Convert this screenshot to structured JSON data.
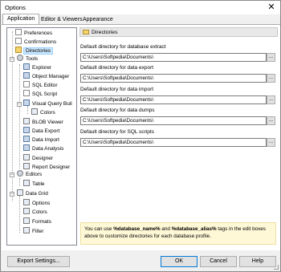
{
  "window": {
    "title": "Options",
    "close_glyph": "✕"
  },
  "tabs": [
    {
      "label": "Application",
      "active": true
    },
    {
      "label": "Editor & Viewers"
    },
    {
      "label": "Appearance"
    }
  ],
  "tree": {
    "items": [
      {
        "label": "Preferences",
        "icon": "preferences-icon"
      },
      {
        "label": "Confirmations",
        "icon": "confirmations-icon"
      },
      {
        "label": "Directories",
        "icon": "folder-icon",
        "selected": true
      },
      {
        "label": "Tools",
        "icon": "tools-icon"
      },
      {
        "label": "Explorer",
        "icon": "explorer-icon"
      },
      {
        "label": "Object Manager",
        "icon": "object-manager-icon"
      },
      {
        "label": "SQL Editor",
        "icon": "sql-editor-icon"
      },
      {
        "label": "SQL Script",
        "icon": "sql-script-icon"
      },
      {
        "label": "Visual Query Buil",
        "icon": "visual-query-icon"
      },
      {
        "label": "Colors",
        "icon": "colors-icon"
      },
      {
        "label": "BLOB Viewer",
        "icon": "blob-viewer-icon"
      },
      {
        "label": "Data Export",
        "icon": "data-export-icon"
      },
      {
        "label": "Data Import",
        "icon": "data-import-icon"
      },
      {
        "label": "Data Analysis",
        "icon": "data-analysis-icon"
      },
      {
        "label": "Designer",
        "icon": "designer-icon"
      },
      {
        "label": "Report Designer",
        "icon": "report-designer-icon"
      },
      {
        "label": "Editors",
        "icon": "editors-icon"
      },
      {
        "label": "Table",
        "icon": "table-icon"
      },
      {
        "label": "Data Grid",
        "icon": "data-grid-icon"
      },
      {
        "label": "Options",
        "icon": "options-icon"
      },
      {
        "label": "Colors",
        "icon": "colors-icon"
      },
      {
        "label": "Formats",
        "icon": "formats-icon"
      },
      {
        "label": "Filter",
        "icon": "filter-icon"
      }
    ]
  },
  "panel": {
    "title": "Directories",
    "fields": [
      {
        "label": "Default directory for database extract",
        "value": "C:\\Users\\Softpedia\\Documents\\"
      },
      {
        "label": "Default directory for data export",
        "value": "C:\\Users\\Softpedia\\Documents\\"
      },
      {
        "label": "Default directory for data import",
        "value": "C:\\Users\\Softpedia\\Documents\\"
      },
      {
        "label": "Default directory for data dumps",
        "value": "C:\\Users\\Softpedia\\Documents\\"
      },
      {
        "label": "Default directory for SQL scripts",
        "value": "C:\\Users\\Softpedia\\Documents\\"
      }
    ],
    "browse_label": "...",
    "info": {
      "prefix": "You can use ",
      "tag1": "%database_name%",
      "mid": " and ",
      "tag2": "%database_alias%",
      "suffix": " tags in the edit boxes above to customize directories for each database profile."
    }
  },
  "buttons": {
    "export": "Export Settings...",
    "ok": "OK",
    "cancel": "Cancel",
    "help": "Help"
  }
}
